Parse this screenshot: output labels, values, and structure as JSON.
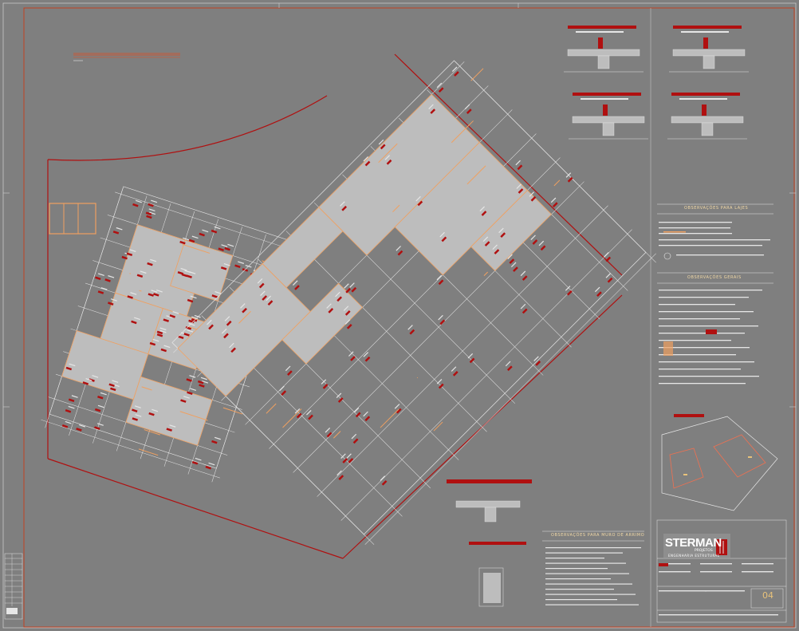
{
  "drawing": {
    "plan_title": "",
    "sheet_number": "04",
    "notes": {
      "slabs_title": "OBSERVAÇÕES PARA LAJES",
      "general_title": "OBSERVAÇÕES GERAIS",
      "retaining_wall_title": "OBSERVAÇÕES PARA MURO DE ARRIMO"
    },
    "title_block": {
      "brand": "STERMAN",
      "brand_sub_1": "PROJETOS",
      "brand_sub_2": "ENGENHARIA ESTRUTURAL"
    }
  },
  "colors": {
    "background": "#7f7f7f",
    "line_white": "#e6e6e6",
    "line_red": "#b01010",
    "line_orange": "#f0a060",
    "fill_light": "#bdbdbd",
    "border": "#c04020"
  }
}
